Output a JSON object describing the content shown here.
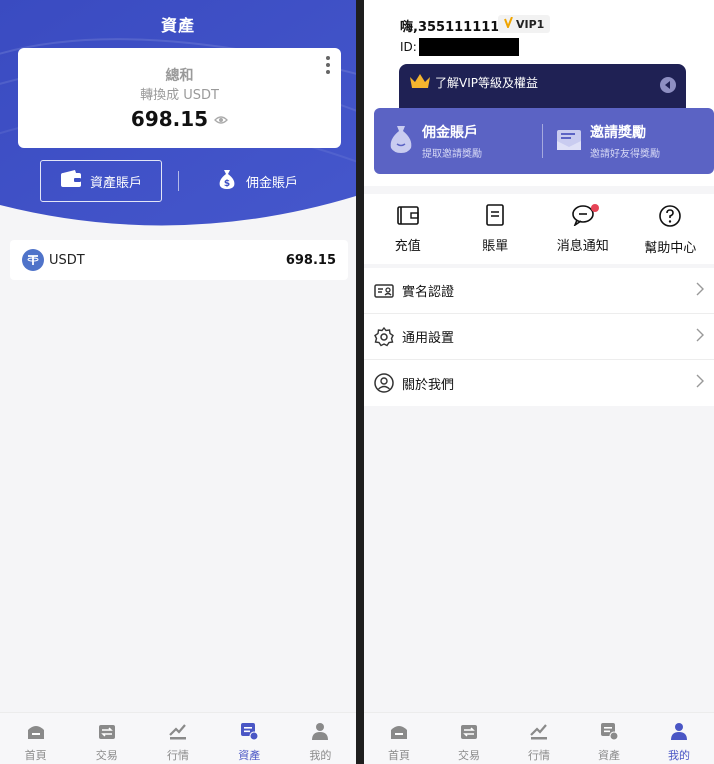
{
  "left_screen": {
    "title": "資產",
    "summary": {
      "label": "總和",
      "sublabel": "轉換成 USDT",
      "amount": "698.15"
    },
    "account_tabs": [
      {
        "label": "資產賬戶",
        "active": true
      },
      {
        "label": "佣金賬戶",
        "active": false
      }
    ],
    "assets": [
      {
        "name": "USDT",
        "value": "698.15"
      }
    ]
  },
  "right_screen": {
    "greeting": "嗨,355111111",
    "vip_level": "VIP1",
    "id_label": "ID:",
    "vip_banner": "了解VIP等級及權益",
    "commission": {
      "title": "佣金賬戶",
      "subtitle": "提取邀請獎勵"
    },
    "invite": {
      "title": "邀請獎勵",
      "subtitle": "邀請好友得獎勵"
    },
    "quick_actions": [
      {
        "label": "充值",
        "icon": "wallet-icon"
      },
      {
        "label": "賬單",
        "icon": "bill-icon"
      },
      {
        "label": "消息通知",
        "icon": "message-icon",
        "has_badge": true
      },
      {
        "label": "幫助中心",
        "icon": "help-icon"
      }
    ],
    "menu": [
      {
        "label": "實名認證",
        "icon": "id-card-icon"
      },
      {
        "label": "通用設置",
        "icon": "settings-icon"
      },
      {
        "label": "關於我們",
        "icon": "user-icon"
      }
    ]
  },
  "tabbar": {
    "items": [
      "首頁",
      "交易",
      "行情",
      "資產",
      "我的"
    ],
    "left_active": "資產",
    "right_active": "我的"
  },
  "colors": {
    "accent": "#4a56c5",
    "hero_blue": "#3d4fc4",
    "commission_bar": "#5b63c4",
    "vip_banner": "#1f2154",
    "notification_dot": "#e64456"
  }
}
